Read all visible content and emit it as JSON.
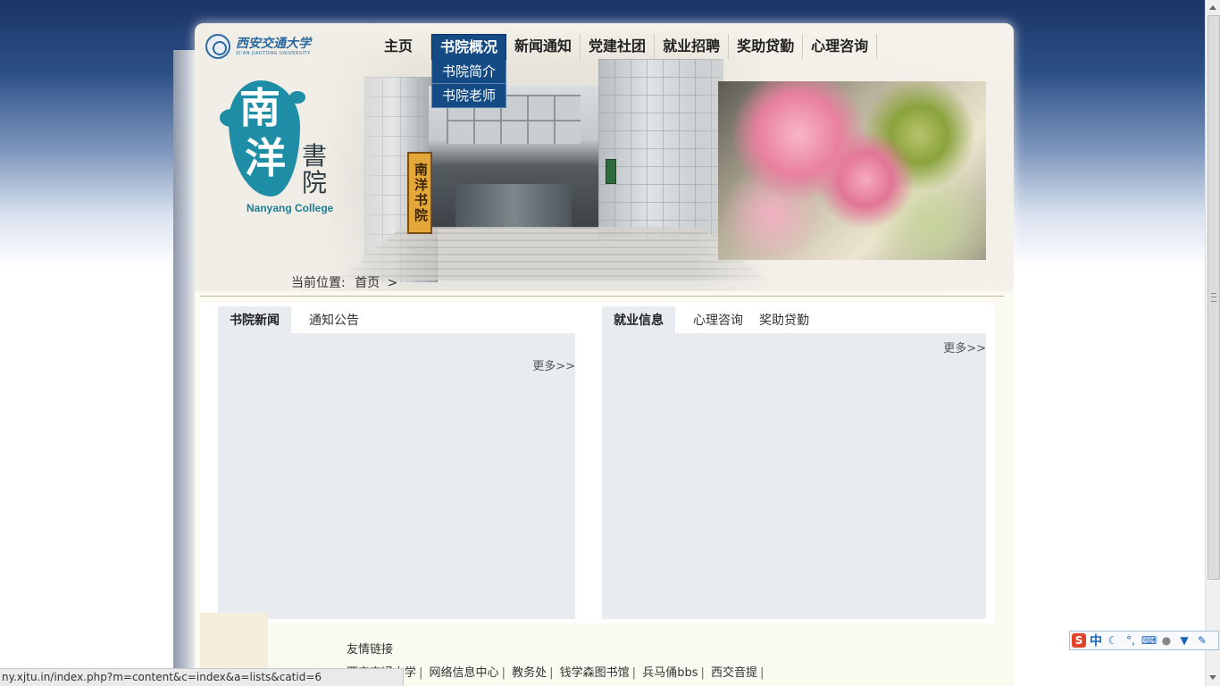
{
  "nav": {
    "items": [
      {
        "label": "主页"
      },
      {
        "label": "书院概况"
      },
      {
        "label": "新闻通知"
      },
      {
        "label": "党建社团"
      },
      {
        "label": "就业招聘"
      },
      {
        "label": "奖助贷勤"
      },
      {
        "label": "心理咨询"
      }
    ],
    "dropdown": [
      "书院简介",
      "书院老师"
    ]
  },
  "logos": {
    "university_name": "西安交通大学",
    "university_en": "XI'AN JIAOTONG UNIVERSITY",
    "college_ch1": "南",
    "college_ch2": "洋",
    "college_ch3": "書",
    "college_ch4": "院",
    "college_en": "Nanyang College",
    "plaque_text": "南洋书院"
  },
  "breadcrumb": {
    "label": "当前位置:",
    "home": "首页",
    "arrow": ">"
  },
  "left_panel": {
    "tabs": [
      "书院新闻",
      "通知公告"
    ],
    "more": "更多>>"
  },
  "right_panel": {
    "tabs": [
      "就业信息",
      "心理咨询",
      "奖助贷勤"
    ],
    "more": "更多>>"
  },
  "links": {
    "title": "友情链接",
    "items": [
      "西安交通大学",
      "网络信息中心",
      "教务处",
      "钱学森图书馆",
      "兵马俑bbs",
      "西交音提"
    ],
    "separator": "|"
  },
  "status_bar": "ny.xjtu.in/index.php?m=content&c=index&a=lists&catid=6",
  "ime": {
    "logo": "S",
    "mode": "中"
  },
  "colors": {
    "nav_active": "#144b84",
    "panel_bg": "#e8ecf0",
    "college_teal": "#1d8ea6"
  }
}
